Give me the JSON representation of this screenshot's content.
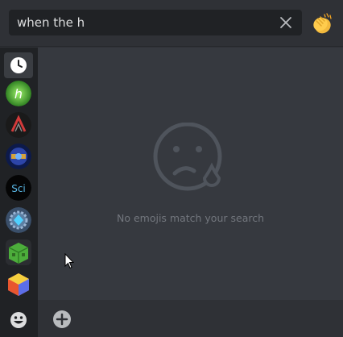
{
  "search": {
    "value": "when the h",
    "placeholder": ""
  },
  "empty_state": {
    "message": "No emojis match your search"
  },
  "categories": [
    {
      "name": "recent-category"
    },
    {
      "name": "server-h"
    },
    {
      "name": "server-a"
    },
    {
      "name": "server-blue"
    },
    {
      "name": "server-sci"
    },
    {
      "name": "server-gear"
    },
    {
      "name": "server-block"
    },
    {
      "name": "server-cube"
    }
  ],
  "icons": {
    "clear": "close-icon",
    "skin_tone": "clapping-hands-icon",
    "add": "add-circle-icon",
    "smiley": "smiley-icon",
    "sad": "sad-face-icon"
  },
  "colors": {
    "accent_text": "#dcddde",
    "muted_text": "#72767d",
    "background": "#36393f",
    "sidebar": "#202225"
  },
  "server_labels": {
    "h": "h",
    "sci": "Sci"
  }
}
